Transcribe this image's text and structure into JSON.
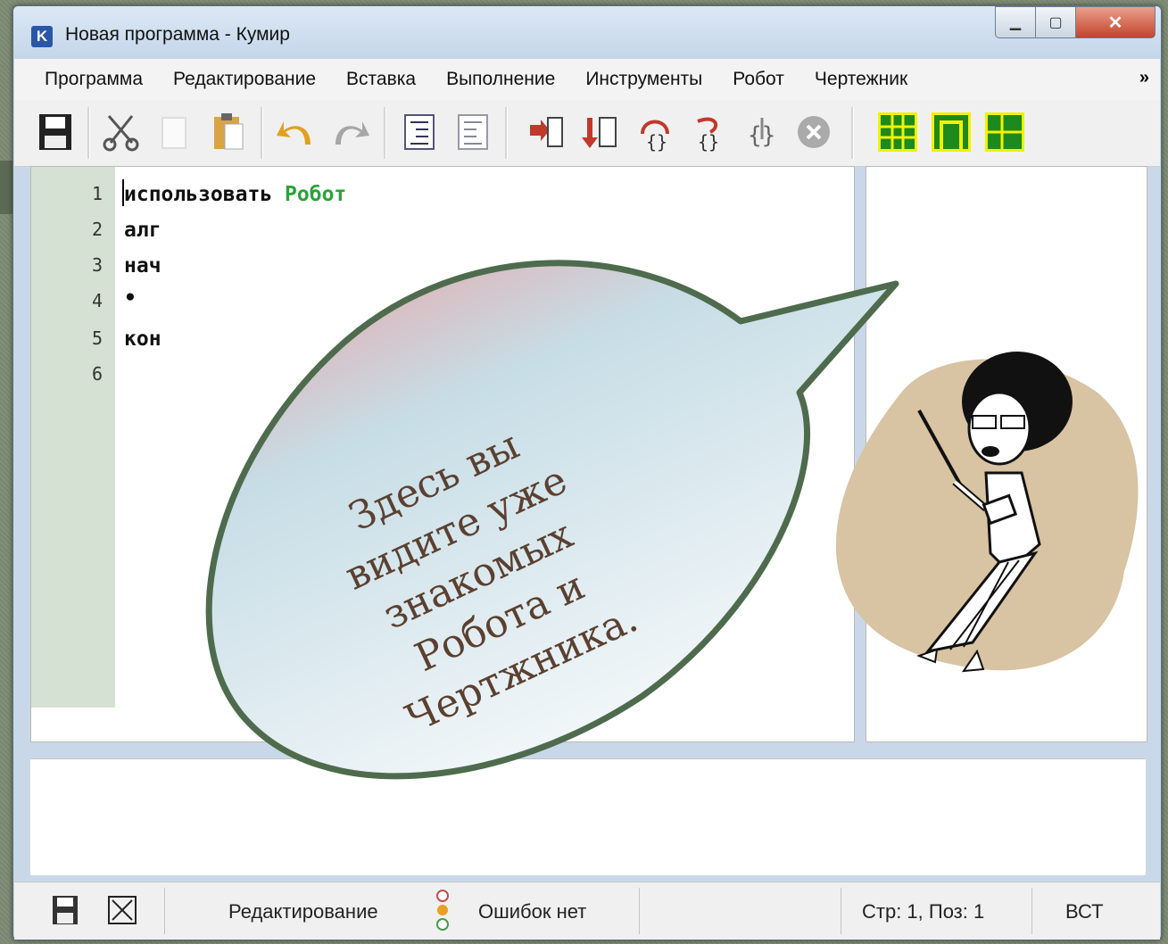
{
  "window": {
    "title": "Новая программа - Кумир",
    "app_icon_letter": "K"
  },
  "menu": {
    "items": [
      "Программа",
      "Редактирование",
      "Вставка",
      "Выполнение",
      "Инструменты",
      "Робот",
      "Чертежник"
    ],
    "more": "»"
  },
  "editor": {
    "lines": [
      {
        "number": "1",
        "keyword": "использовать",
        "actor": "Робот"
      },
      {
        "number": "2",
        "keyword": "алг",
        "actor": ""
      },
      {
        "number": "3",
        "keyword": "нач",
        "actor": ""
      },
      {
        "number": "4",
        "keyword": "•",
        "actor": ""
      },
      {
        "number": "5",
        "keyword": "кон",
        "actor": ""
      },
      {
        "number": "6",
        "keyword": "",
        "actor": ""
      }
    ]
  },
  "callout": {
    "lines": [
      "Здесь вы",
      "видите уже",
      "знакомых",
      "Робота и",
      "Чертжника."
    ]
  },
  "statusbar": {
    "mode": "Редактирование",
    "errors": "Ошибок нет",
    "position": "Стр: 1, Поз: 1",
    "insert_mode": "ВСТ"
  },
  "colors": {
    "actor_keyword": "#2aa33a",
    "gutter": "#d5e1d2",
    "bubble_border": "#4e6b4e"
  }
}
